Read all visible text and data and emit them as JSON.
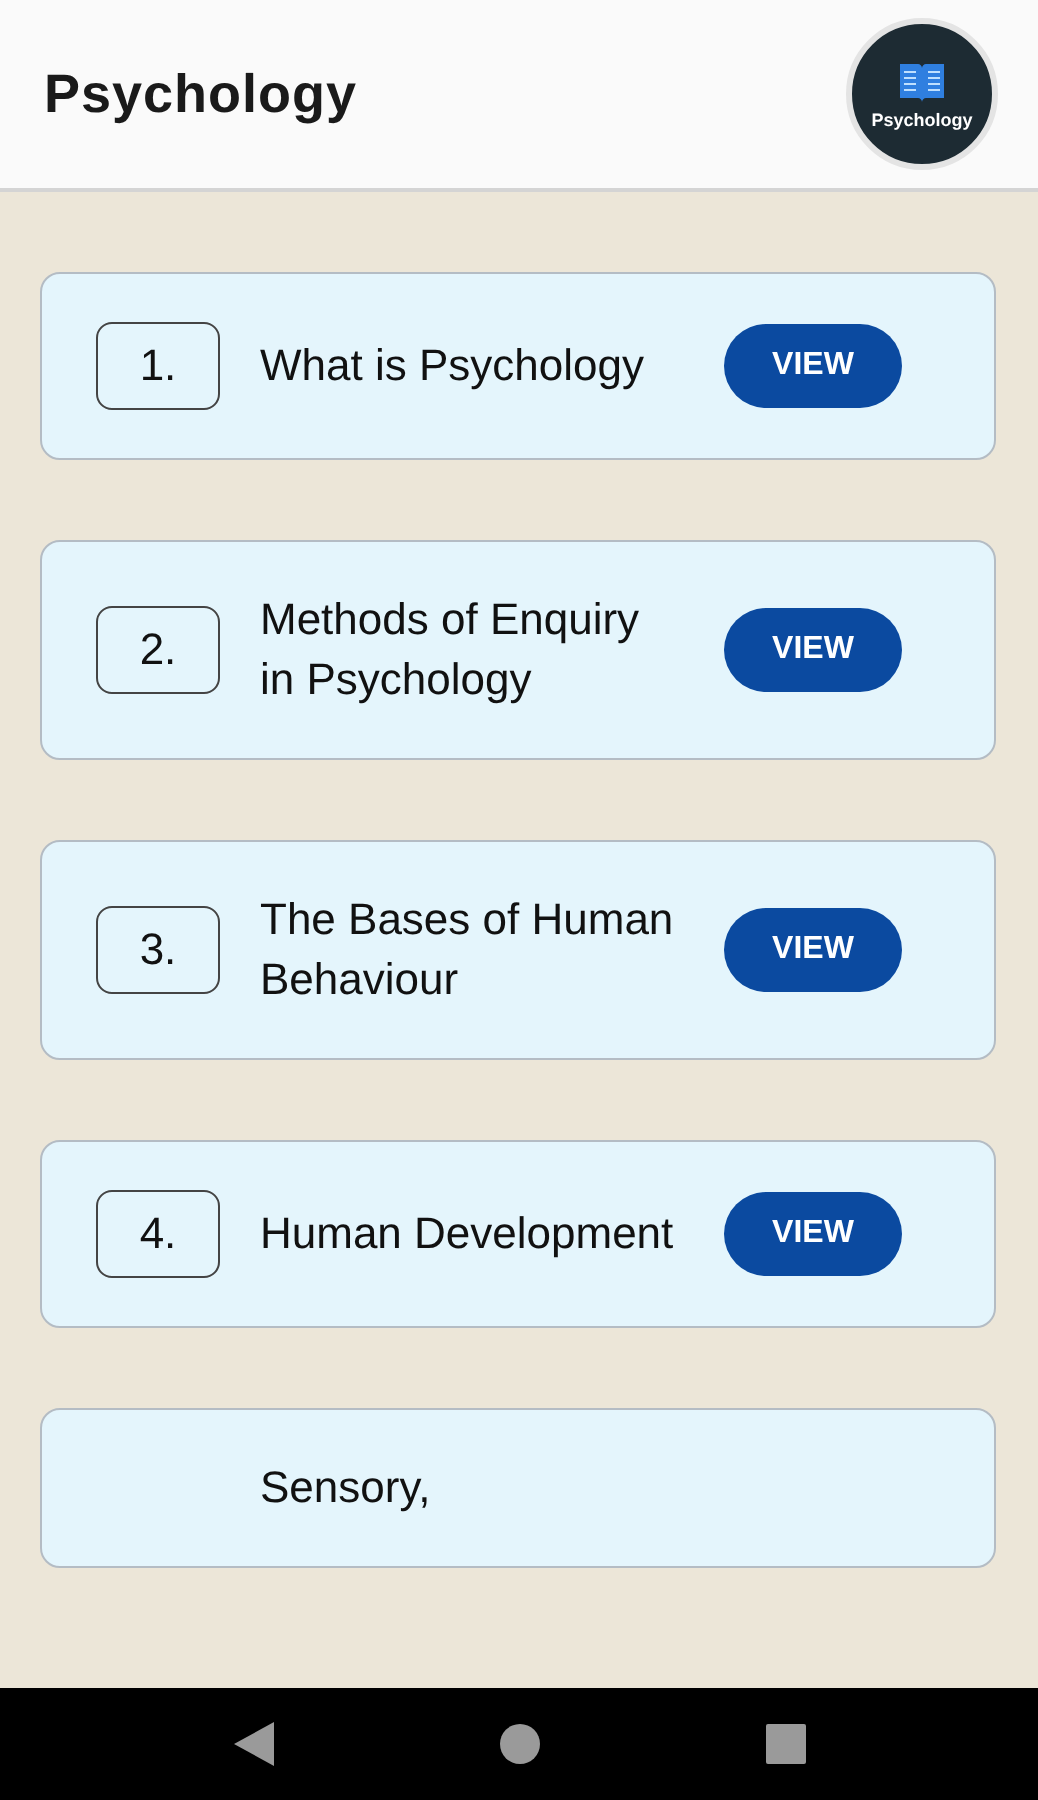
{
  "app_bar": {
    "title": "Psychology",
    "logo_text": "Psychology"
  },
  "chapters": [
    {
      "number": "1.",
      "title": "What is Psychology",
      "button": "VIEW"
    },
    {
      "number": "2.",
      "title": "Methods of Enquiry in Psychology",
      "button": "VIEW"
    },
    {
      "number": "3.",
      "title": "The Bases of Human Behaviour",
      "button": "VIEW"
    },
    {
      "number": "4.",
      "title": "Human Development",
      "button": "VIEW"
    },
    {
      "title": "Sensory,"
    }
  ]
}
